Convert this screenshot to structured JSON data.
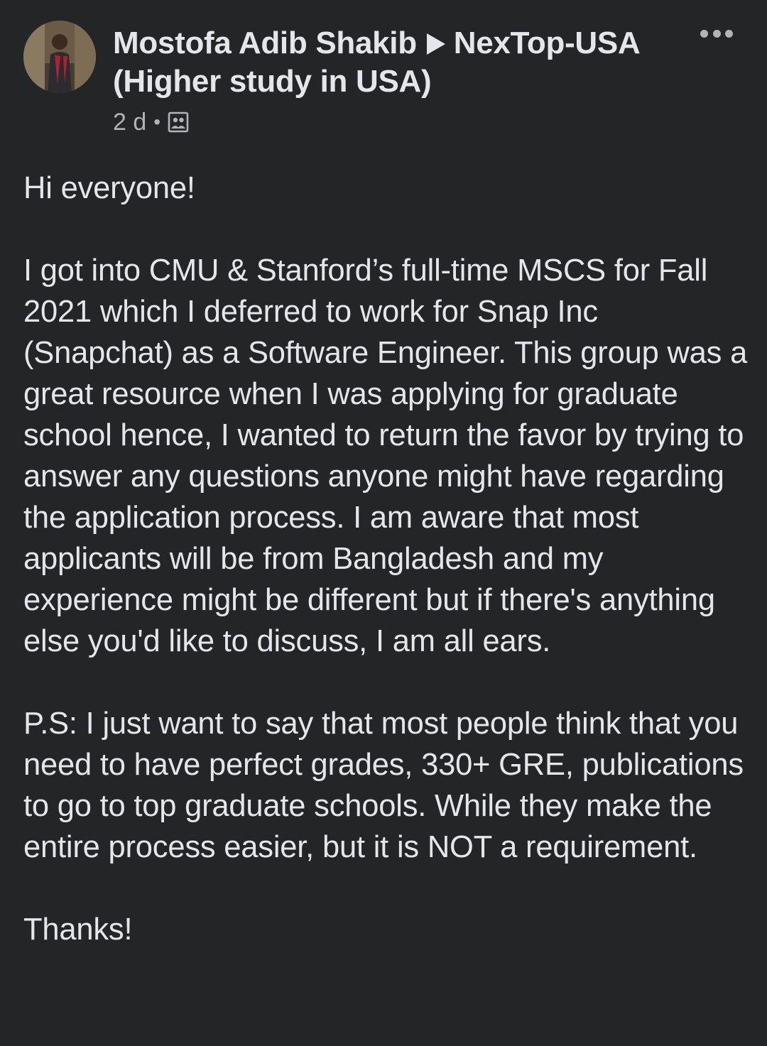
{
  "post": {
    "author": "Mostofa Adib Shakib",
    "group_line1": "NexTop-USA",
    "group_line2": "(Higher study in USA)",
    "time": "2 d",
    "separator": "•",
    "audience_icon": "group-icon",
    "more_icon": "more-options-icon",
    "paragraphs": [
      "Hi everyone!",
      "I got into CMU & Stanford’s full-time MSCS for Fall 2021 which I deferred to work for Snap Inc (Snapchat) as a Software Engineer. This group was a great resource when I was applying for graduate school hence, I wanted to return the favor by trying to answer any questions anyone might have regarding the application process. I am aware that most applicants will be from Bangladesh and my experience might be different but if there's anything else you'd like to discuss, I am all ears.",
      "P.S: I just want to say that most people think that you need to have perfect grades, 330+ GRE, publications to go to top graduate schools. While they make the entire process easier, but it is NOT a requirement.",
      "Thanks!"
    ]
  },
  "colors": {
    "background": "#242526",
    "primary_text": "#e4e6eb",
    "secondary_text": "#b0b3b8"
  }
}
